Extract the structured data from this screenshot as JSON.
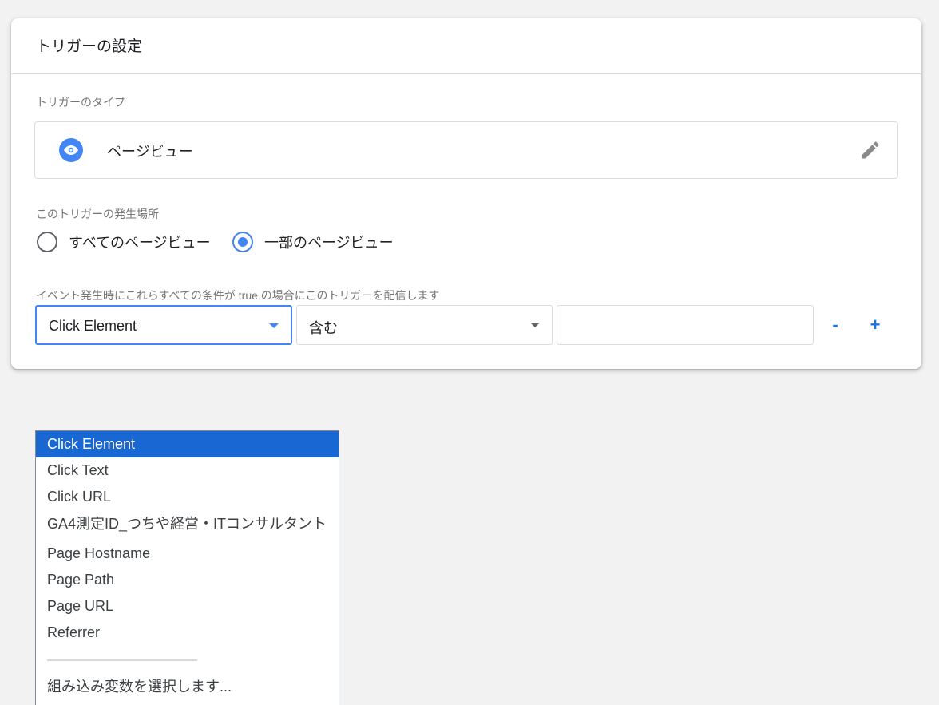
{
  "card": {
    "title": "トリガーの設定",
    "type_section_label": "トリガーのタイプ",
    "trigger_type": "ページビュー",
    "fire_on_label": "このトリガーの発生場所",
    "fire_on_options": [
      {
        "label": "すべてのページビュー",
        "checked": false
      },
      {
        "label": "一部のページビュー",
        "checked": true
      }
    ],
    "condition_label": "イベント発生時にこれらすべての条件が true の場合にこのトリガーを配信します",
    "condition": {
      "variable": "Click Element",
      "operator": "含む",
      "value": ""
    },
    "remove_label": "-",
    "add_label": "+"
  },
  "dropdown": {
    "items": [
      {
        "label": "Click Element",
        "selected": true
      },
      {
        "label": "Click Text",
        "selected": false
      },
      {
        "label": "Click URL",
        "selected": false
      },
      {
        "label": "GA4測定ID_つちや経営・ITコンサルタント",
        "selected": false
      },
      {
        "label": "Page Hostname",
        "selected": false
      },
      {
        "label": "Page Path",
        "selected": false
      },
      {
        "label": "Page URL",
        "selected": false
      },
      {
        "label": "Referrer",
        "selected": false
      }
    ],
    "builtin_label": "組み込み変数を選択します..."
  },
  "icons": {
    "trigger_type": "eye-icon",
    "edit": "pencil-icon",
    "dropdown_caret": "chevron-down-icon"
  },
  "colors": {
    "accent": "#4285f4",
    "selected_item": "#1967d2",
    "background": "#f1f2f1"
  }
}
